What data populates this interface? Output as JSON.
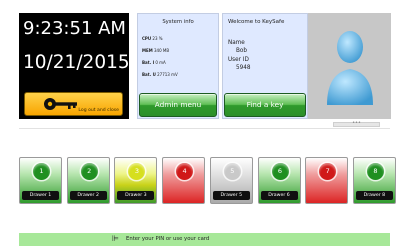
{
  "clock": {
    "time": "9:23:51 AM",
    "date": "10/21/2015",
    "logout_label": "Log out and close",
    "key_icon": "key-icon"
  },
  "system_info": {
    "title": "System info",
    "cpu_label": "CPU",
    "cpu_value": "23 %",
    "mem_label": "MEM",
    "mem_value": "340 MB",
    "bat_i_label": "Bat. I",
    "bat_i_value": "0 mA",
    "bat_u_label": "Bat. U",
    "bat_u_value": "27713 mV",
    "admin_button": "Admin menu"
  },
  "welcome": {
    "title": "Welcome to KeySafe",
    "name_label": "Name",
    "name_value": "Bob",
    "userid_label": "User ID",
    "userid_value": "5948",
    "find_button": "Find a key"
  },
  "avatar": {
    "icon": "user-avatar-icon"
  },
  "scroll": {
    "glyph": "•••"
  },
  "drawers": [
    {
      "number": "1",
      "label": "Drawer 1",
      "state": "green"
    },
    {
      "number": "2",
      "label": "Drawer 2",
      "state": "green"
    },
    {
      "number": "3",
      "label": "Drawer 3",
      "state": "yellow"
    },
    {
      "number": "4",
      "label": "",
      "state": "red"
    },
    {
      "number": "5",
      "label": "Drawer 5",
      "state": "grey"
    },
    {
      "number": "6",
      "label": "Drawer 6",
      "state": "green"
    },
    {
      "number": "7",
      "label": "",
      "state": "red"
    },
    {
      "number": "8",
      "label": "Drawer 8",
      "state": "green"
    }
  ],
  "footer": {
    "prompt": "Enter your PIN or use your card",
    "icon": "antenna-icon"
  },
  "colors": {
    "clock_bg": "#000000",
    "panel_bg": "#dfe9ff",
    "button_green": "#2f9a2c",
    "logout_orange": "#f8a500",
    "drawer_red": "#dc2424",
    "drawer_yellow": "#d6df1e",
    "footer_green": "#a7e899"
  }
}
